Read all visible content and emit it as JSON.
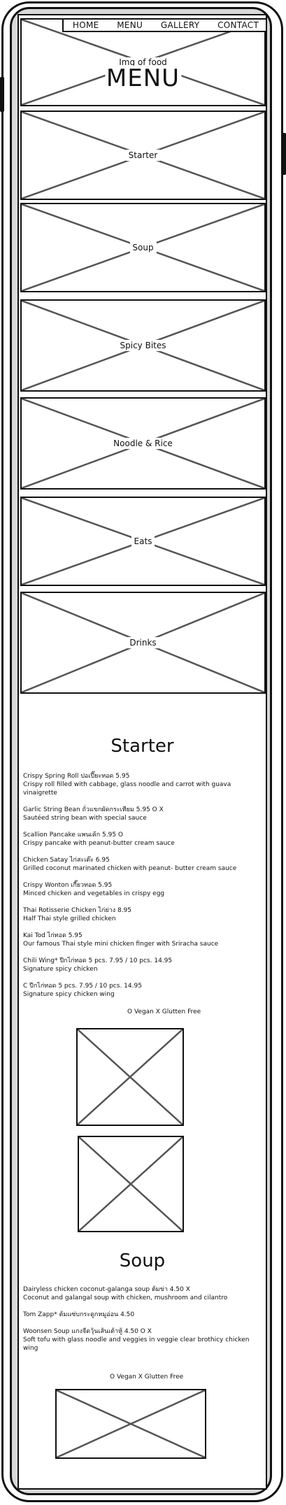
{
  "nav": {
    "items": [
      "HOME",
      "MENU",
      "GALLERY",
      "CONTACT"
    ]
  },
  "hero": {
    "image_label": "Img of food",
    "title": "MENU"
  },
  "categories": [
    "Starter",
    "Soup",
    "Spicy Bites",
    "Noodle & Rice",
    "Eats",
    "Drinks"
  ],
  "starter": {
    "title": "Starter",
    "items": [
      {
        "name": "Crispy Spring Roll ปอเปี๊ยะทอด   5.95",
        "desc": "Crispy roll filled with cabbage, glass noodle and carrot with guava vinaigrette"
      },
      {
        "name": "Garlic String Bean ถั่วแขกผัดกระเทียม   5.95 O X",
        "desc": "Sautéed  string bean with special sauce"
      },
      {
        "name": "Scallion Pancake แพนเค้ก   5.95 O",
        "desc": "Crispy pancake with peanut-butter cream sauce"
      },
      {
        "name": "Chicken Satay ไก่สะเต๊ะ   6.95",
        "desc": "Grilled coconut marinated chicken with peanut- butter cream sauce"
      },
      {
        "name": "Crispy Wonton เกี๊ยวทอด   5.95",
        "desc": "Minced chicken and vegetables in crispy egg"
      },
      {
        "name": "Thai Rotisserie Chicken ไก่ย่าง   8.95",
        "desc": "Half Thai style grilled chicken"
      },
      {
        "name": "Kai Tod ไก่ทอด   5.95",
        "desc": "Our famous Thai style mini chicken finger with Sriracha sauce"
      },
      {
        "name": "Chili Wing* ปีกไก่ทอด   5 pcs. 7.95 / 10 pcs. 14.95",
        "desc": "Signature spicy chicken"
      },
      {
        "name": "C ปีกไก่ทอด   5 pcs. 7.95 / 10 pcs. 14.95",
        "desc": "Signature spicy chicken wing"
      }
    ],
    "legend": "O Vegan  X Glutten Free"
  },
  "soup": {
    "title": "Soup",
    "items": [
      {
        "name": "Dairyless chicken coconut-galanga soup ต้มข่า 4.50 X",
        "desc": "Coconut and galangal soup with chicken, mushroom and cilantro"
      },
      {
        "name": "Tom Zapp* ต้มแซ่บกระดูกหมูอ่อน   4.50",
        "desc": ""
      },
      {
        "name": "Woonsen Soup แกงจืดวุ้นเส้นเต้าหู้ 4.50 O X",
        "desc": "Soft tofu with glass noodle and veggies in veggie clear brothicy chicken wing"
      }
    ],
    "legend": "O Vegan  X Glutten Free"
  }
}
